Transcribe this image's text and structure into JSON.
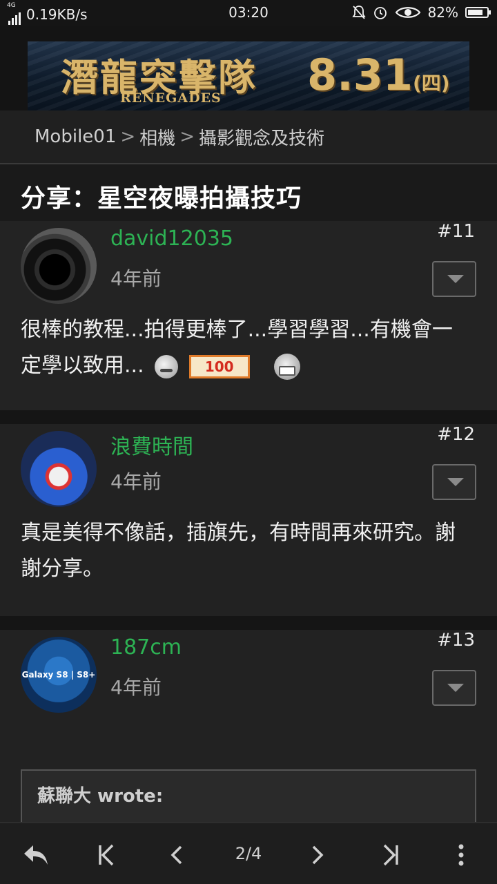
{
  "status_bar": {
    "network_type": "4G",
    "speed": "0.19KB/s",
    "time": "03:20",
    "battery": "82%",
    "battery_level": 0.82,
    "icons": [
      "signal-icon",
      "mute-icon",
      "alarm-icon",
      "eye-icon",
      "battery-icon"
    ]
  },
  "banner": {
    "title": "潛龍突擊隊",
    "subtitle": "RENEGADES",
    "date": "8.31",
    "weekday": "(四)"
  },
  "breadcrumb": {
    "items": [
      "Mobile01",
      "相機",
      "攝影觀念及技術"
    ],
    "separator": ">"
  },
  "thread": {
    "title": "分享：星空夜曝拍攝技巧"
  },
  "posts": [
    {
      "username": "david12035",
      "time": "4年前",
      "number": "#11",
      "body": "很棒的教程...拍得更棒了...學習學習...有機會一定學以致用...",
      "emoticon_text": "100"
    },
    {
      "username": "浪費時間",
      "time": "4年前",
      "number": "#12",
      "body": "真是美得不像話，插旗先，有時間再來研究。謝謝分享。"
    },
    {
      "username": "187cm",
      "time": "4年前",
      "number": "#13",
      "avatar_text": "Galaxy S8 | S8+",
      "quote_author": "蘇聯大 wrote:"
    }
  ],
  "toolbar": {
    "page_indicator": "2/4",
    "icons": [
      "reply-icon",
      "first-page-icon",
      "prev-page-icon",
      "next-page-icon",
      "last-page-icon",
      "more-icon"
    ]
  },
  "colors": {
    "username": "#2db354",
    "background": "#1a1a1a",
    "post_background": "#222222"
  }
}
